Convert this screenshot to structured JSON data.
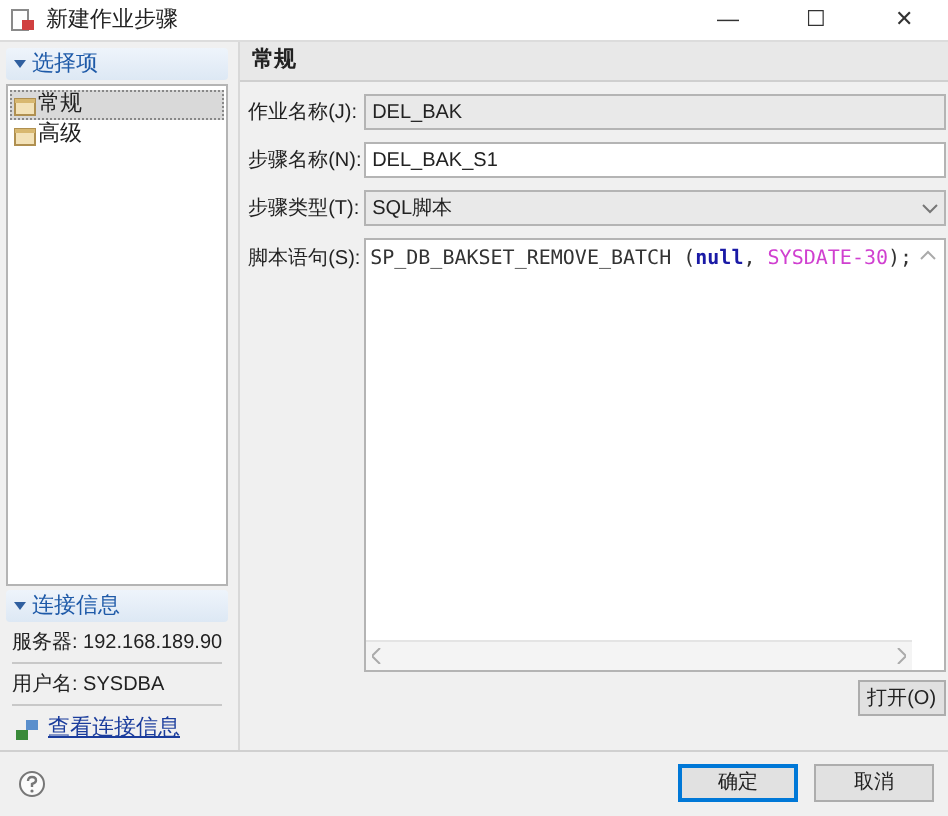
{
  "window": {
    "title": "新建作业步骤",
    "controls": [
      "—",
      "☐",
      "✕"
    ]
  },
  "sidebar": {
    "header": "选择项",
    "expanded": true,
    "items": [
      {
        "label": "常规",
        "selected": true
      },
      {
        "label": "高级",
        "selected": false
      }
    ]
  },
  "connection": {
    "header": "连接信息",
    "expanded": true,
    "rows": [
      {
        "text": "服务器: 192.168.189.90"
      },
      {
        "text": "用户名: SYSDBA"
      }
    ],
    "link": "查看连接信息"
  },
  "section": {
    "title": "常规"
  },
  "form": [
    {
      "kind": "text",
      "label": "作业名称(J):",
      "value": "DEL_BAK",
      "disabled": true
    },
    {
      "kind": "text",
      "label": "步骤名称(N):",
      "value": "DEL_BAK_S1",
      "disabled": false
    },
    {
      "kind": "select",
      "label": "步骤类型(T):",
      "value": "SQL脚本",
      "disabled": true
    }
  ],
  "script": {
    "label": "脚本语句(S):",
    "tokens": [
      {
        "kind": "plain",
        "text": "SP_DB_BAKSET_REMOVE_BATCH ("
      },
      {
        "kind": "keyword",
        "text": "null"
      },
      {
        "kind": "plain",
        "text": ", "
      },
      {
        "kind": "builtin",
        "text": "SYSDATE"
      },
      {
        "kind": "number",
        "text": "-30"
      },
      {
        "kind": "plain",
        "text": ");"
      }
    ],
    "open_button": "打开(O)"
  },
  "buttons": [
    {
      "label": "确定",
      "default": true
    },
    {
      "label": "取消",
      "default": false
    }
  ]
}
